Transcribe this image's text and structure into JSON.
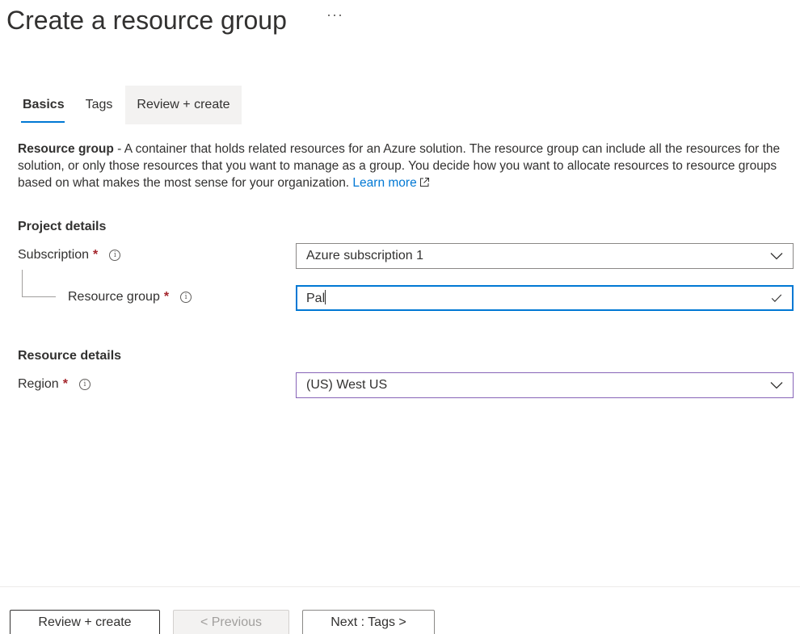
{
  "header": {
    "title": "Create a resource group",
    "more_label": "···"
  },
  "tabs": [
    {
      "label": "Basics",
      "active": true
    },
    {
      "label": "Tags",
      "active": false
    },
    {
      "label": "Review + create",
      "active": false
    }
  ],
  "description": {
    "bold": "Resource group",
    "text": " - A container that holds related resources for an Azure solution. The resource group can include all the resources for the solution, or only those resources that you want to manage as a group. You decide how you want to allocate resources to resource groups based on what makes the most sense for your organization. ",
    "link": "Learn more"
  },
  "project_details": {
    "heading": "Project details",
    "subscription": {
      "label": "Subscription",
      "required": "*",
      "value": "Azure subscription 1"
    },
    "resource_group": {
      "label": "Resource group",
      "required": "*",
      "value": "Pal"
    }
  },
  "resource_details": {
    "heading": "Resource details",
    "region": {
      "label": "Region",
      "required": "*",
      "value": "(US) West US"
    }
  },
  "footer": {
    "review_create": "Review + create",
    "previous": "< Previous",
    "next": "Next : Tags >"
  },
  "icons": {
    "info": "info-icon",
    "chevron": "chevron-down-icon",
    "check": "checkmark-icon",
    "external": "external-link-icon"
  },
  "colors": {
    "accent": "#0078d4",
    "required": "#a4262c",
    "region_border": "#8764b8"
  }
}
